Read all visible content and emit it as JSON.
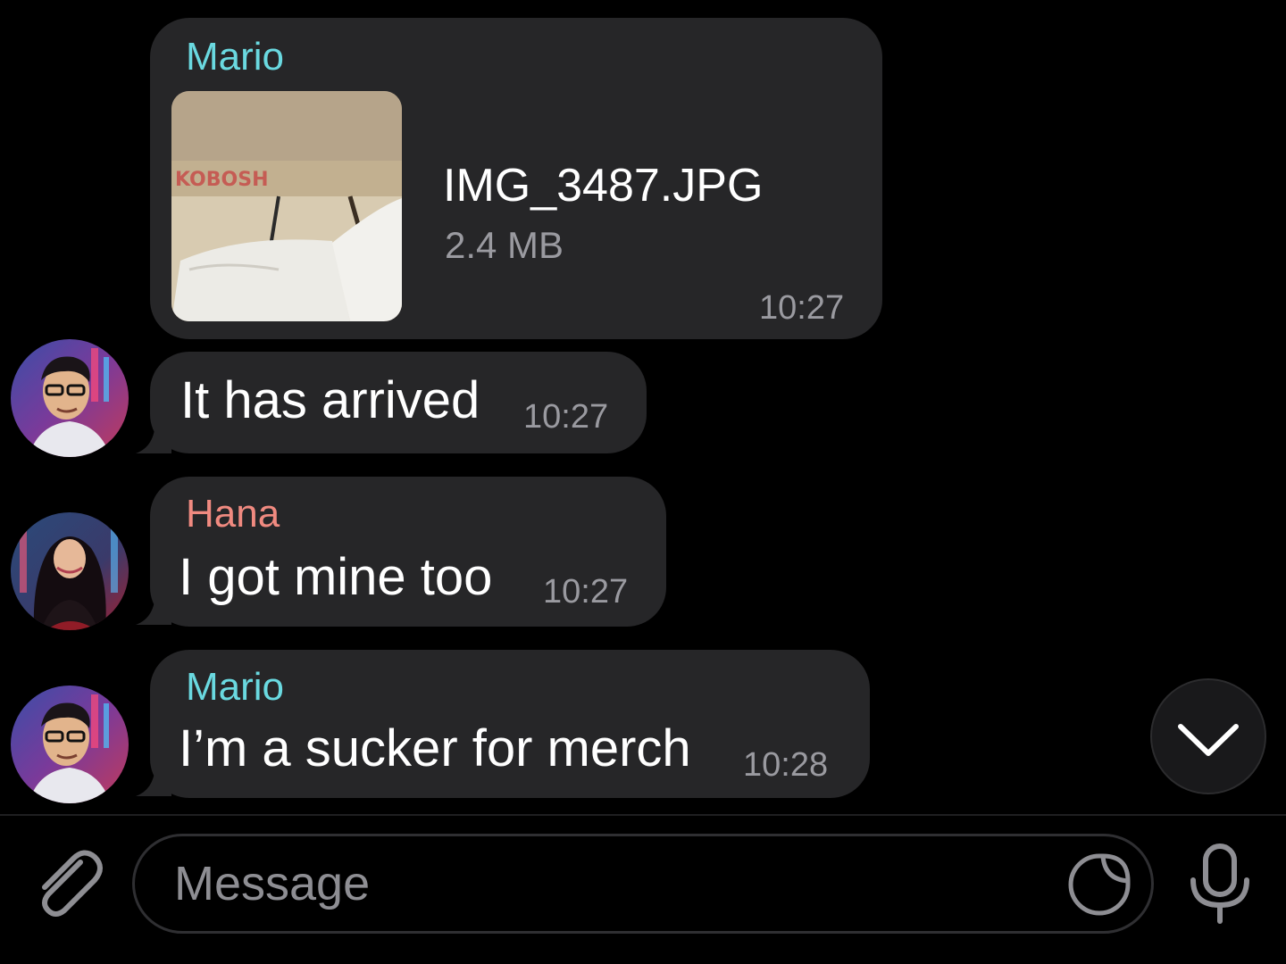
{
  "messages": [
    {
      "sender": "Mario",
      "sender_color": "#6ad9e0",
      "file_name": "IMG_3487.JPG",
      "file_size": "2.4 MB",
      "time": "10:27"
    },
    {
      "text": "It has arrived",
      "time": "10:27"
    },
    {
      "sender": "Hana",
      "sender_color": "#f08a80",
      "text": "I got mine too",
      "time": "10:27"
    },
    {
      "sender": "Mario",
      "sender_color": "#6ad9e0",
      "text": "I’m a sucker for merch",
      "time": "10:28"
    }
  ],
  "input": {
    "placeholder": "Message"
  },
  "icons": {
    "attach": "paperclip-icon",
    "sticker": "sticker-icon",
    "mic": "microphone-icon",
    "scroll_down": "chevron-down-icon"
  },
  "colors": {
    "background": "#000000",
    "bubble": "#262628",
    "timestamp": "#9a9aa0",
    "icon": "#8e8e93"
  }
}
